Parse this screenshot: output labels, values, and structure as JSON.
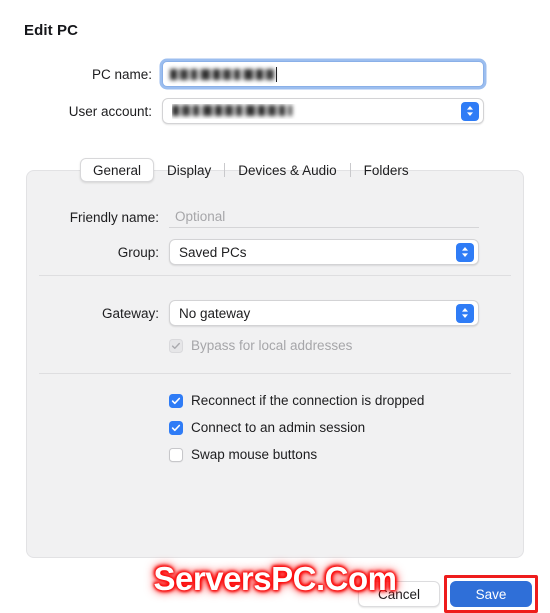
{
  "dialog": {
    "title": "Edit PC"
  },
  "top_form": {
    "pc_name": {
      "label": "PC name:",
      "value": "",
      "redacted": true
    },
    "user_account": {
      "label": "User account:",
      "value": "",
      "redacted": true
    }
  },
  "tabs": [
    {
      "label": "General",
      "selected": true
    },
    {
      "label": "Display",
      "selected": false
    },
    {
      "label": "Devices & Audio",
      "selected": false
    },
    {
      "label": "Folders",
      "selected": false
    }
  ],
  "general": {
    "friendly_name": {
      "label": "Friendly name:",
      "value": "",
      "placeholder": "Optional"
    },
    "group": {
      "label": "Group:",
      "value": "Saved PCs"
    },
    "gateway": {
      "label": "Gateway:",
      "value": "No gateway"
    },
    "bypass_local": {
      "label": "Bypass for local addresses",
      "checked": true,
      "disabled": true
    },
    "options": [
      {
        "label": "Reconnect if the connection is dropped",
        "checked": true
      },
      {
        "label": "Connect to an admin session",
        "checked": true
      },
      {
        "label": "Swap mouse buttons",
        "checked": false
      }
    ]
  },
  "footer": {
    "cancel_label": "Cancel",
    "save_label": "Save"
  },
  "watermark": {
    "text": "ServersPC.Com"
  },
  "colors": {
    "accent": "#2f7cf6",
    "save_button": "#2f6fd8",
    "annotation": "#ee1c1c",
    "panel_bg": "#f1f1f2",
    "watermark": "#ff1111"
  },
  "icons": {
    "stepper": "chevron-up-down-icon",
    "checkmark": "checkmark-icon"
  }
}
